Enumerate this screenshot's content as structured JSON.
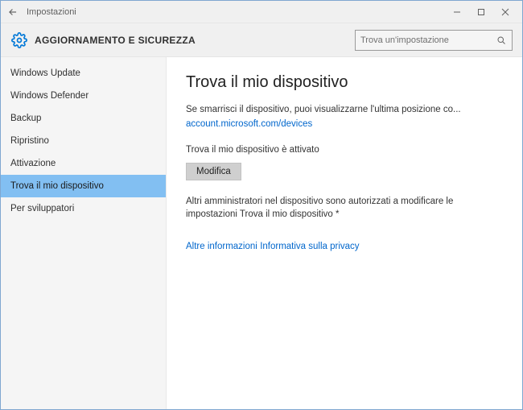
{
  "titlebar": {
    "app_name": "Impostazioni"
  },
  "header": {
    "section_title": "AGGIORNAMENTO E SICUREZZA",
    "search_placeholder": "Trova un'impostazione"
  },
  "sidebar": {
    "items": [
      {
        "label": "Windows Update",
        "selected": false
      },
      {
        "label": "Windows Defender",
        "selected": false
      },
      {
        "label": "Backup",
        "selected": false
      },
      {
        "label": "Ripristino",
        "selected": false
      },
      {
        "label": "Attivazione",
        "selected": false
      },
      {
        "label": "Trova il mio dispositivo",
        "selected": true
      },
      {
        "label": "Per sviluppatori",
        "selected": false
      }
    ]
  },
  "main": {
    "heading": "Trova il mio dispositivo",
    "lost_text": "Se smarrisci il dispositivo, puoi visualizzarne l'ultima posizione co...",
    "account_link": "account.microsoft.com/devices",
    "status_text": "Trova il mio dispositivo è attivato",
    "modify_button": "Modifica",
    "admin_text": "Altri amministratori nel dispositivo sono autorizzati a modificare le impostazioni Trova il mio dispositivo *",
    "more_info_link": "Altre informazioni",
    "privacy_link": "Informativa sulla privacy"
  }
}
